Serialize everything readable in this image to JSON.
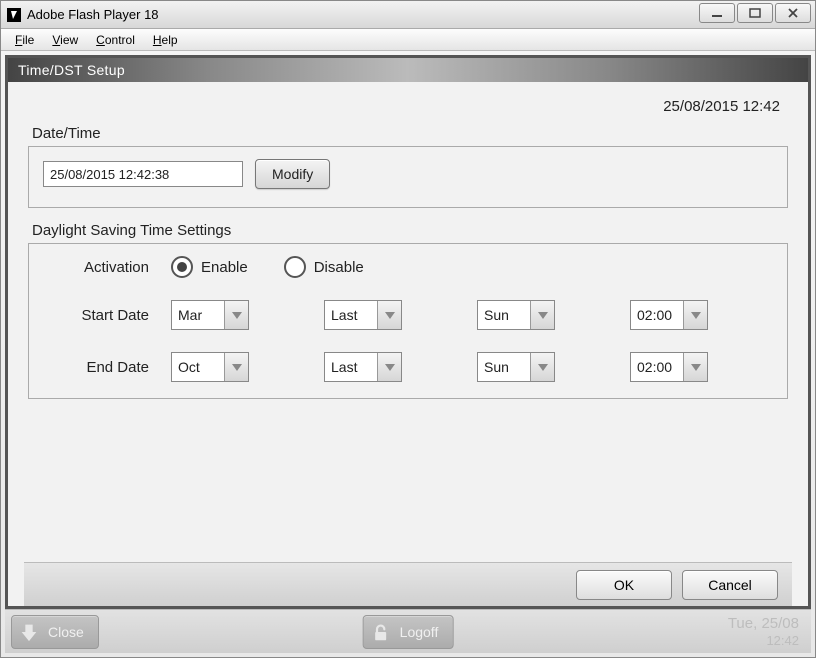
{
  "window": {
    "title": "Adobe Flash Player 18"
  },
  "menu": {
    "items": [
      "File",
      "View",
      "Control",
      "Help"
    ]
  },
  "page": {
    "header": "Time/DST Setup",
    "clock": "25/08/2015 12:42"
  },
  "datetime": {
    "legend": "Date/Time",
    "value": "25/08/2015 12:42:38",
    "modify_label": "Modify"
  },
  "dst": {
    "legend": "Daylight Saving Time Settings",
    "activation_label": "Activation",
    "enable_label": "Enable",
    "disable_label": "Disable",
    "activation": "enable",
    "start_label": "Start Date",
    "end_label": "End Date",
    "start": {
      "month": "Mar",
      "week": "Last",
      "day": "Sun",
      "time": "02:00"
    },
    "end": {
      "month": "Oct",
      "week": "Last",
      "day": "Sun",
      "time": "02:00"
    }
  },
  "buttons": {
    "ok": "OK",
    "cancel": "Cancel"
  },
  "status": {
    "close": "Close",
    "logoff": "Logoff",
    "date_line1": "Tue, 25/08",
    "date_line2": "12:42"
  }
}
